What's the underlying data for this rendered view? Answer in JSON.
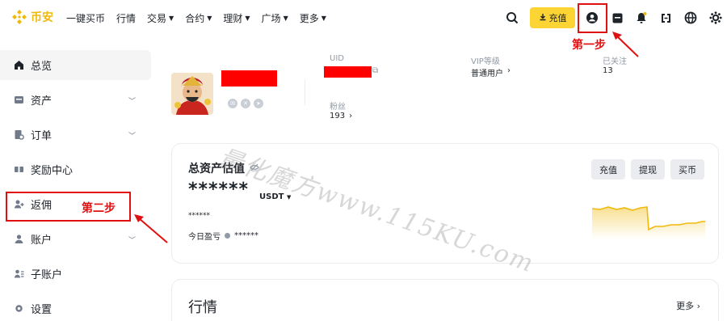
{
  "logo": {
    "text": "币安"
  },
  "nav": {
    "items": [
      {
        "label": "一键买币",
        "has_caret": false
      },
      {
        "label": "行情",
        "has_caret": false
      },
      {
        "label": "交易",
        "has_caret": true
      },
      {
        "label": "合约",
        "has_caret": true
      },
      {
        "label": "理财",
        "has_caret": true
      },
      {
        "label": "广场",
        "has_caret": true
      },
      {
        "label": "更多",
        "has_caret": true
      }
    ],
    "deposit_label": "充值",
    "icons": [
      "search-icon",
      "account-icon",
      "orders-icon",
      "notification-icon",
      "download-icon",
      "globe-icon",
      "settings-icon"
    ]
  },
  "sidebar": {
    "items": [
      {
        "label": "总览",
        "icon": "home-icon",
        "active": true,
        "chevron": false
      },
      {
        "label": "资产",
        "icon": "wallet-icon",
        "active": false,
        "chevron": true
      },
      {
        "label": "订单",
        "icon": "orders-icon",
        "active": false,
        "chevron": true
      },
      {
        "label": "奖励中心",
        "icon": "rewards-icon",
        "active": false,
        "chevron": false
      },
      {
        "label": "返佣",
        "icon": "referral-icon",
        "active": false,
        "chevron": false
      },
      {
        "label": "账户",
        "icon": "user-icon",
        "active": false,
        "chevron": true
      },
      {
        "label": "子账户",
        "icon": "sub-account-icon",
        "active": false,
        "chevron": false
      },
      {
        "label": "设置",
        "icon": "settings-icon",
        "active": false,
        "chevron": false
      }
    ]
  },
  "profile": {
    "uid_label": "UID",
    "vip_label": "VIP等级",
    "vip_value": "普通用户",
    "following_label": "已关注",
    "following_value": "13",
    "followers_label": "粉丝",
    "followers_value": "193"
  },
  "assets": {
    "title": "总资产估值",
    "masked_total": "******",
    "unit": "USDT",
    "masked_sub": "******",
    "pnl_label": "今日盈亏",
    "pnl_value": "******",
    "buttons": [
      "充值",
      "提现",
      "买币"
    ]
  },
  "market": {
    "title": "行情",
    "more_label": "更多"
  },
  "annotations": {
    "step1": "第一步",
    "step2": "第二步",
    "watermark": "量化魔方www.115KU.com"
  },
  "colors": {
    "brand": "#f0b90b",
    "button_yellow": "#fcd535",
    "annotation_red": "#e01010",
    "redaction": "#ff0000"
  }
}
